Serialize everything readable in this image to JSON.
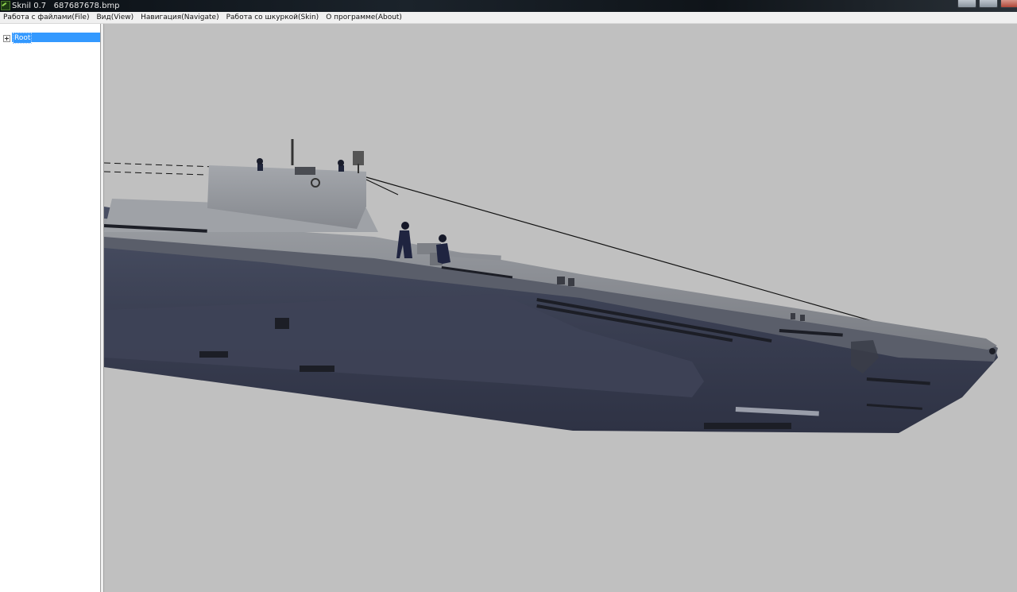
{
  "window": {
    "title": "Sknil 0.7   687687678.bmp"
  },
  "menu": [
    {
      "label": "Работа с файлами(File)"
    },
    {
      "label": "Вид(View)"
    },
    {
      "label": "Навигация(Navigate)"
    },
    {
      "label": "Работа со шкуркой(Skin)"
    },
    {
      "label": "О программе(About)"
    }
  ],
  "tree": {
    "root_label": "Root",
    "expand_icon": "plus-box-icon"
  },
  "viewport": {
    "background": "#c0c0c0",
    "subject": "submarine-3d-model",
    "hull_color": "#3a3f52",
    "deck_color": "#8a8d92"
  },
  "colors": {
    "selection": "#3399ff",
    "menubar": "#f0f0f0",
    "panel": "#ffffff"
  }
}
